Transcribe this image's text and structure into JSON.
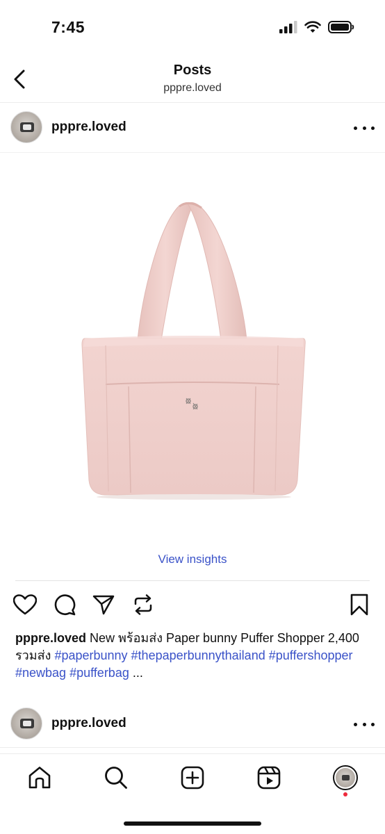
{
  "status_bar": {
    "time": "7:45"
  },
  "nav": {
    "title": "Posts",
    "subtitle": "pppre.loved"
  },
  "post": {
    "username": "pppre.loved",
    "insights_label": "View insights",
    "caption": {
      "username": "pppre.loved",
      "text": "New พร้อมส่ง Paper bunny Puffer Shopper 2,400 รวมส่ง",
      "hashtags": [
        "#paperbunny",
        "#thepaperbunnythailand",
        "#puffershopper",
        "#newbag",
        "#pufferbag"
      ],
      "more": "..."
    },
    "image": {
      "subject": "pink puffer tote bag",
      "bag_color": "#efcfcb"
    }
  },
  "next_post": {
    "username": "pppre.loved"
  },
  "icons": {
    "back": "chevron-left-icon",
    "more": "more-horizontal-icon",
    "like": "heart-icon",
    "comment": "comment-icon",
    "share": "send-icon",
    "repost": "repost-icon",
    "save": "bookmark-icon",
    "home": "home-icon",
    "search": "search-icon",
    "create": "plus-square-icon",
    "reels": "reels-icon",
    "profile": "profile-avatar"
  },
  "colors": {
    "link": "#3a52c8",
    "notification": "#ee2a3c"
  }
}
